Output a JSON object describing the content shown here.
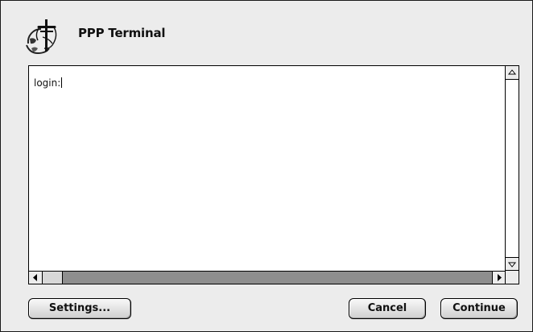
{
  "window": {
    "title": "PPP Terminal",
    "icon": "ppp-globe-icon"
  },
  "terminal": {
    "text": "login:",
    "scroll_up_icon": "triangle-up-icon",
    "scroll_down_icon": "triangle-down-icon",
    "scroll_left_icon": "triangle-left-icon",
    "scroll_right_icon": "triangle-right-icon"
  },
  "buttons": {
    "settings_label": "Settings...",
    "cancel_label": "Cancel",
    "continue_label": "Continue"
  },
  "colors": {
    "dialog_bg": "#ececec",
    "scrollbar_track": "#8e8e8e"
  }
}
